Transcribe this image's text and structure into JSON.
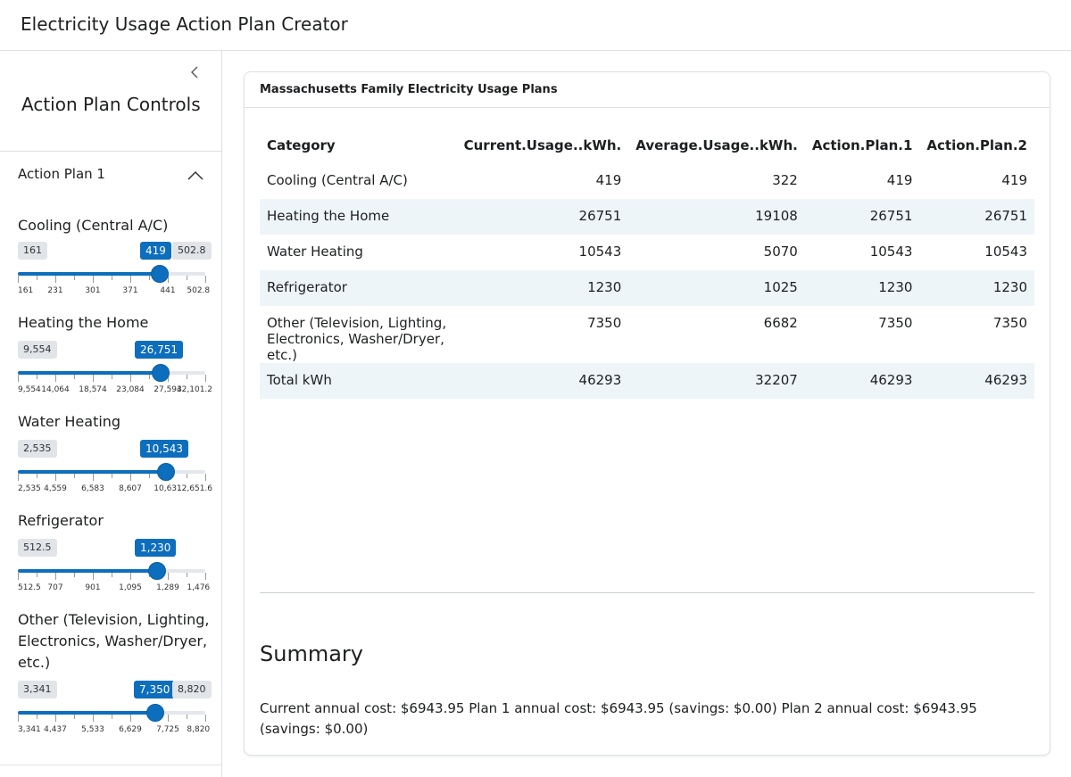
{
  "app": {
    "title": "Electricity Usage Action Plan Creator"
  },
  "sidebar": {
    "title": "Action Plan Controls",
    "accordion": {
      "title": "Action Plan 1"
    },
    "sliders": [
      {
        "label": "Cooling (Central A/C)",
        "min": "161",
        "value": "419",
        "max": "502.8",
        "fraction": 0.755,
        "ticks": [
          "161",
          "231",
          "301",
          "371",
          "441",
          "502.8"
        ]
      },
      {
        "label": "Heating the Home",
        "min": "9,554",
        "value": "26,751",
        "max": "",
        "fraction": 0.763,
        "ticks": [
          "9,554",
          "14,064",
          "18,574",
          "23,084",
          "27,594",
          "32,101.2"
        ]
      },
      {
        "label": "Water Heating",
        "min": "2,535",
        "value": "10,543",
        "max": "",
        "fraction": 0.791,
        "ticks": [
          "2,535",
          "4,559",
          "6,583",
          "8,607",
          "10,631",
          "12,651.6"
        ]
      },
      {
        "label": "Refrigerator",
        "min": "512.5",
        "value": "1,230",
        "max": "",
        "fraction": 0.745,
        "ticks": [
          "512.5",
          "707",
          "901",
          "1,095",
          "1,289",
          "1,476"
        ]
      },
      {
        "label": "Other (Television, Lighting, Electronics, Washer/Dryer, etc.)",
        "min": "3,341",
        "value": "7,350",
        "max": "8,820",
        "fraction": 0.732,
        "ticks": [
          "3,341",
          "4,437",
          "5,533",
          "6,629",
          "7,725",
          "8,820"
        ]
      }
    ]
  },
  "card": {
    "title": "Massachusetts Family Electricity Usage Plans",
    "table": {
      "headers": [
        "Category",
        "Current.Usage..kWh.",
        "Average.Usage..kWh.",
        "Action.Plan.1",
        "Action.Plan.2"
      ],
      "rows": [
        [
          "Cooling (Central A/C)",
          "419",
          "322",
          "419",
          "419"
        ],
        [
          "Heating the Home",
          "26751",
          "19108",
          "26751",
          "26751"
        ],
        [
          "Water Heating",
          "10543",
          "5070",
          "10543",
          "10543"
        ],
        [
          "Refrigerator",
          "1230",
          "1025",
          "1230",
          "1230"
        ],
        [
          "Other (Television, Lighting, Electronics, Washer/Dryer, etc.)",
          "7350",
          "6682",
          "7350",
          "7350"
        ],
        [
          "Total kWh",
          "46293",
          "32207",
          "46293",
          "46293"
        ]
      ]
    },
    "summary": {
      "title": "Summary",
      "text": "Current annual cost: $6943.95 Plan 1 annual cost: $6943.95 (savings: $0.00) Plan 2 annual cost: $6943.95 (savings: $0.00)"
    }
  },
  "colors": {
    "accent": "#0d6ebd",
    "stripe": "#eef5f9",
    "border": "#dee2e6"
  }
}
